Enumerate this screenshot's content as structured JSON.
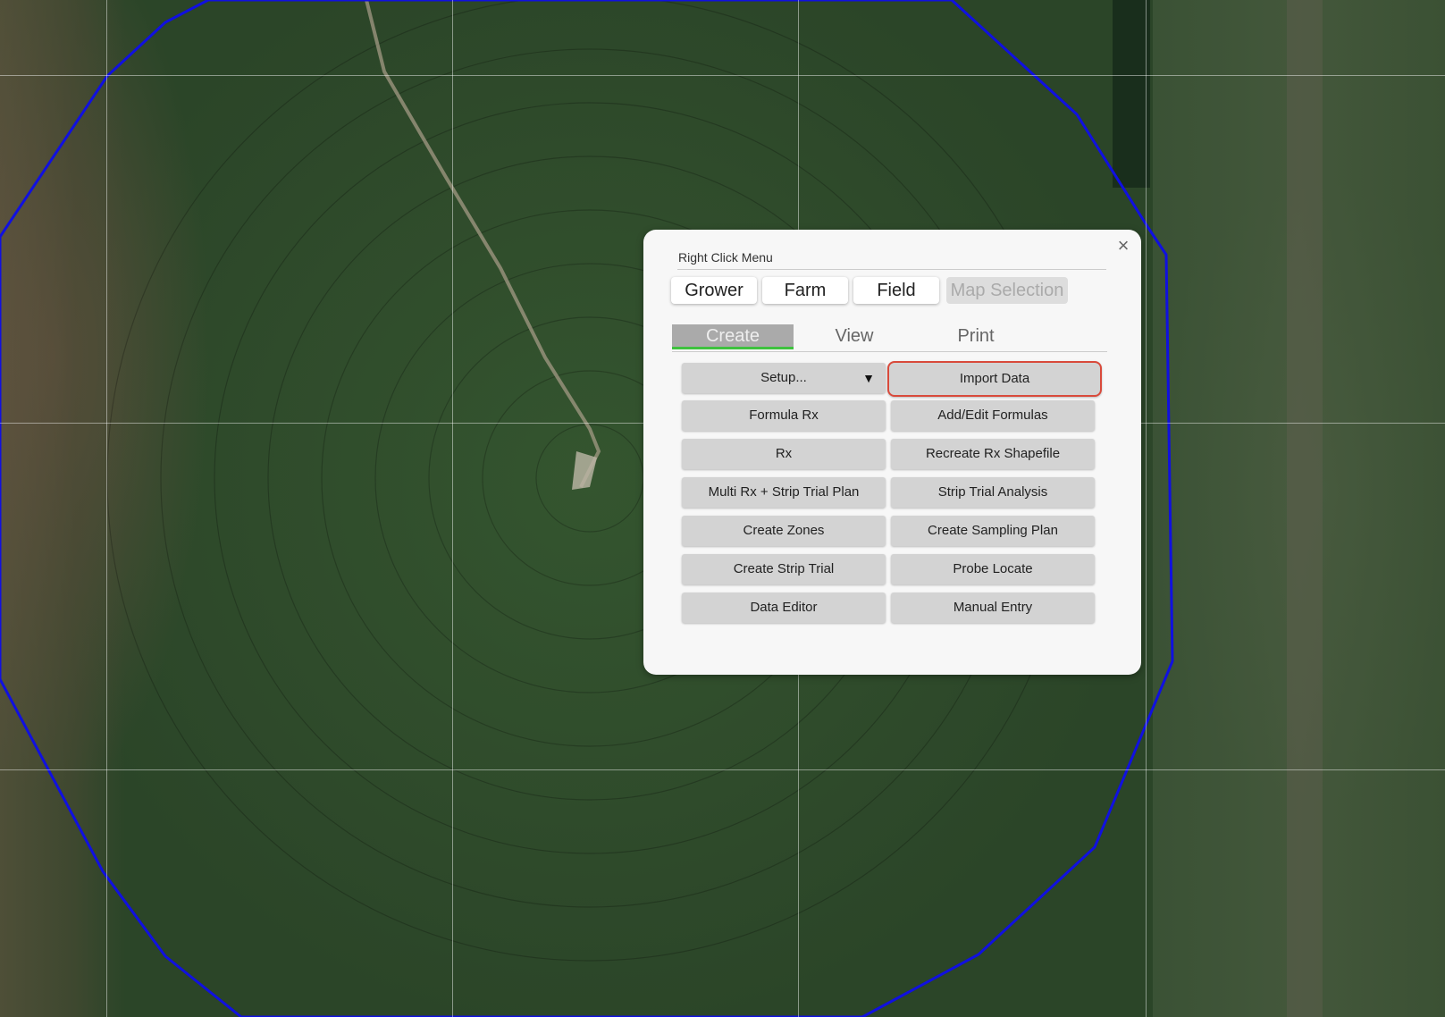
{
  "map": {
    "boundary_color": "#1010e0",
    "grid_color": "#ffffff"
  },
  "menu": {
    "title": "Right Click Menu",
    "close_icon": "close-icon",
    "context_tabs": [
      {
        "label": "Grower",
        "state": "enabled"
      },
      {
        "label": "Farm",
        "state": "enabled"
      },
      {
        "label": "Field",
        "state": "enabled"
      },
      {
        "label": "Map Selection",
        "state": "disabled"
      }
    ],
    "mode_tabs": [
      {
        "label": "Create",
        "active": true
      },
      {
        "label": "View",
        "active": false
      },
      {
        "label": "Print",
        "active": false
      }
    ],
    "active_tab_accent": "#3fc23f",
    "highlight_color": "#d94a3b",
    "buttons": {
      "setup": "Setup...",
      "setup_arrow": "▼",
      "import_data": "Import Data",
      "formula_rx": "Formula Rx",
      "add_edit_formulas": "Add/Edit Formulas",
      "rx": "Rx",
      "recreate_rx_shapefile": "Recreate Rx Shapefile",
      "multi_rx_strip_trial_plan": "Multi Rx + Strip Trial Plan",
      "strip_trial_analysis": "Strip Trial Analysis",
      "create_zones": "Create Zones",
      "create_sampling_plan": "Create Sampling Plan",
      "create_strip_trial": "Create Strip Trial",
      "probe_locate": "Probe Locate",
      "data_editor": "Data Editor",
      "manual_entry": "Manual Entry"
    }
  }
}
